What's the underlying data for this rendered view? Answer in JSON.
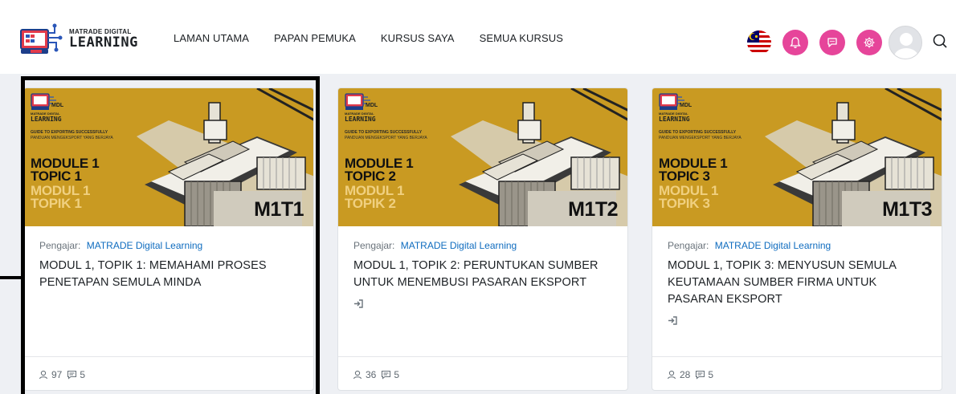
{
  "header": {
    "logo": {
      "small": "MATRADE DIGITAL",
      "big": "LEARNING"
    },
    "nav": [
      "LAMAN UTAMA",
      "PAPAN PEMUKA",
      "KURSUS SAYA",
      "SEMUA KURSUS"
    ],
    "icons": [
      "malaysia-flag-icon",
      "notification-icon",
      "messages-icon",
      "settings-icon",
      "user-avatar",
      "search-icon"
    ],
    "accent": "#e6459a"
  },
  "cards": [
    {
      "thumb_module": [
        "MODULE 1",
        "TOPIC 1"
      ],
      "thumb_modul": [
        "MODUL 1",
        "TOPIK 1"
      ],
      "thumb_code": "M1T1",
      "teacher_label": "Pengajar:",
      "teacher": "MATRADE Digital Learning",
      "title": "MODUL 1, TOPIK 1: MEMAHAMI PROSES PENETAPAN SEMULA MINDA",
      "show_enter": false,
      "participants": "97",
      "forums": "5"
    },
    {
      "thumb_module": [
        "MODULE 1",
        "TOPIC 2"
      ],
      "thumb_modul": [
        "MODUL 1",
        "TOPIK 2"
      ],
      "thumb_code": "M1T2",
      "teacher_label": "Pengajar:",
      "teacher": "MATRADE Digital Learning",
      "title": "MODUL 1, TOPIK 2: PERUNTUKAN SUMBER UNTUK MENEMBUSI PASARAN EKSPORT",
      "show_enter": true,
      "participants": "36",
      "forums": "5"
    },
    {
      "thumb_module": [
        "MODULE 1",
        "TOPIC 3"
      ],
      "thumb_modul": [
        "MODUL 1",
        "TOPIK 3"
      ],
      "thumb_code": "M1T3",
      "teacher_label": "Pengajar:",
      "teacher": "MATRADE Digital Learning",
      "title": "MODUL 1, TOPIK 3: MENYUSUN SEMULA KEUTAMAAN SUMBER FIRMA UNTUK PASARAN EKSPORT",
      "show_enter": true,
      "participants": "28",
      "forums": "5"
    }
  ],
  "thumb_common": {
    "brand": "MDL",
    "brand_sub": "MATRADE DIGITAL",
    "brand_big": "LEARNING",
    "guide_en": "GUIDE TO EXPORTING SUCCESSFULLY",
    "guide_ms": "PANDUAN MENGEKSPORT YANG BERJAYA"
  }
}
